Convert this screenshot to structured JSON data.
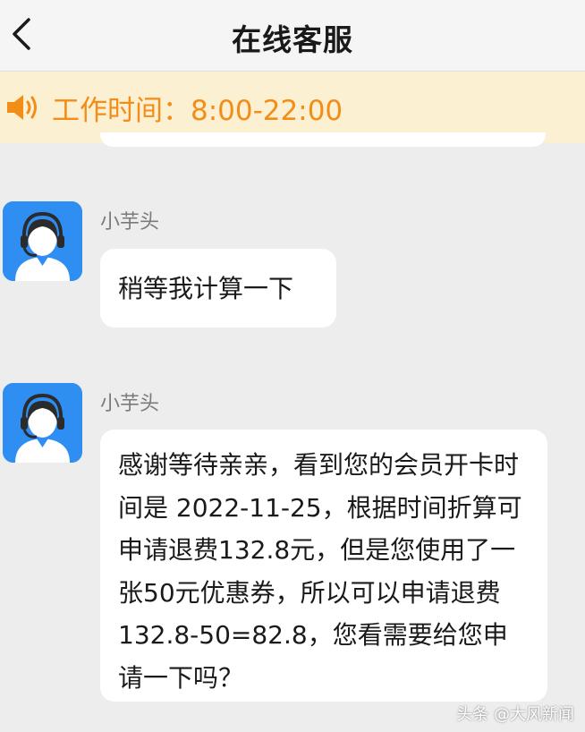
{
  "header": {
    "title": "在线客服"
  },
  "notice": {
    "text": "工作时间：8:00-22:00"
  },
  "messages": [
    {
      "sender": "小芋头",
      "text": "稍等我计算一下"
    },
    {
      "sender": "小芋头",
      "text": "感谢等待亲亲，看到您的会员开卡时间是 2022-11-25，根据时间折算可申请退费132.8元，但是您使用了一张50元优惠券，所以可以申请退费132.8-50=82.8，您看需要给您申请一下吗？"
    }
  ],
  "watermark": "头条 @大风新闻",
  "colors": {
    "background": "#ededed",
    "notice_bg": "#fcf0d2",
    "notice_text": "#f28d18",
    "avatar_bg": "#2f8ef2"
  },
  "icons": {
    "back": "chevron-left-icon",
    "notice": "speaker-icon",
    "avatar": "customer-service-agent-icon"
  }
}
